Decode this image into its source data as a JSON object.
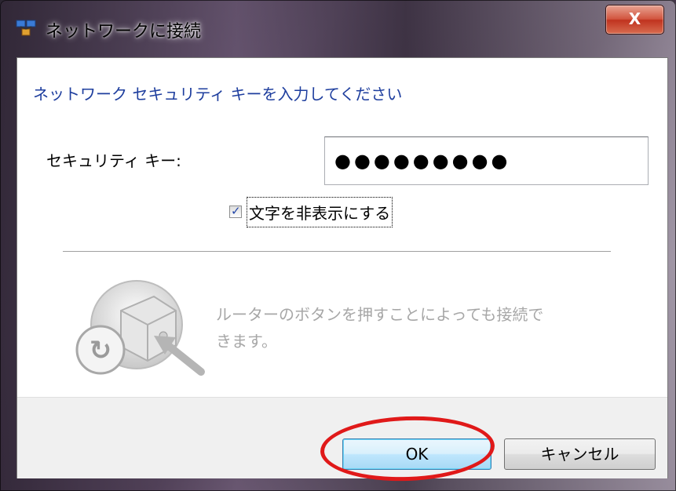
{
  "window": {
    "title": "ネットワークに接続",
    "close_label": "X",
    "title_icon": "network-icon"
  },
  "main": {
    "heading": "ネットワーク セキュリティ キーを入力してください",
    "security_key_label": "セキュリティ キー:",
    "security_key_value": "●●●●●●●●●",
    "hide_characters_label": "文字を非表示にする",
    "hide_characters_checked": true,
    "router_text": "ルーターのボタンを押すことによっても接続できます。",
    "router_icon": "wps-router-icon"
  },
  "footer": {
    "ok_label": "OK",
    "cancel_label": "キャンセル"
  },
  "annotation": {
    "highlight_color": "#e01919"
  },
  "colors": {
    "heading": "#1e3e9e",
    "disabled_text": "#a7a7a7",
    "ok_button_border": "#3c7fb1"
  }
}
